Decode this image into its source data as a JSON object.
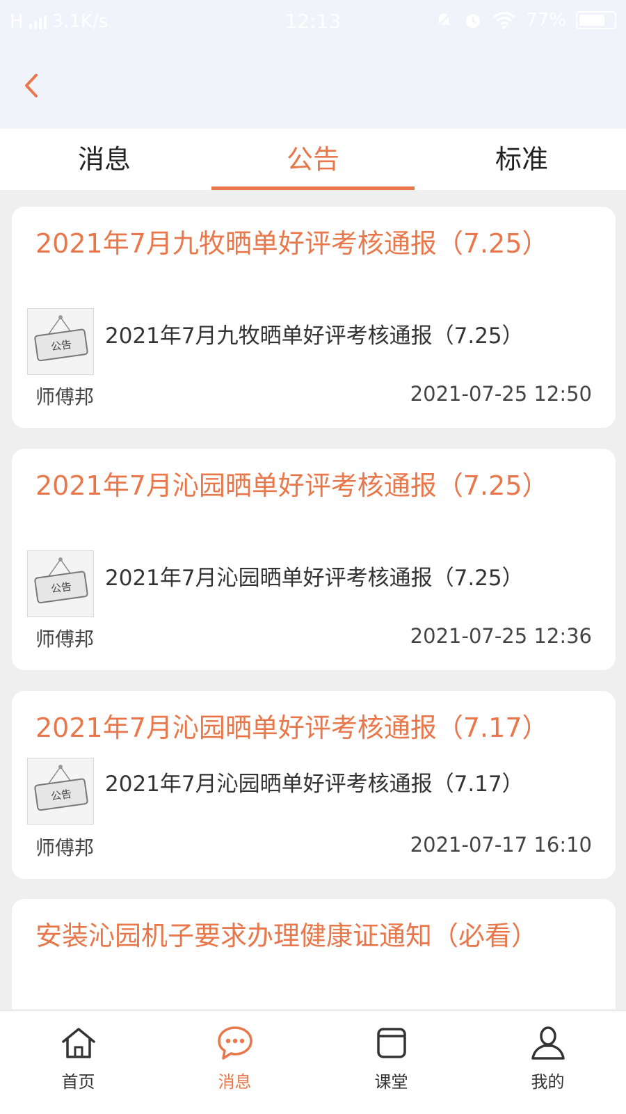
{
  "status_bar": {
    "network": "H",
    "speed": "3.1K/s",
    "time": "12:13",
    "battery": "77%"
  },
  "tabs": [
    {
      "label": "消息",
      "active": false
    },
    {
      "label": "公告",
      "active": true
    },
    {
      "label": "标准",
      "active": false
    }
  ],
  "thumb_label": "公告",
  "notices": [
    {
      "title": "2021年7月九牧晒单好评考核通报（7.25）",
      "summary": "2021年7月九牧晒单好评考核通报（7.25）",
      "author": "师傅邦",
      "time": "2021-07-25 12:50"
    },
    {
      "title": "2021年7月沁园晒单好评考核通报（7.25）",
      "summary": "2021年7月沁园晒单好评考核通报（7.25）",
      "author": "师傅邦",
      "time": "2021-07-25 12:36"
    },
    {
      "title": "2021年7月沁园晒单好评考核通报（7.17）",
      "summary": "2021年7月沁园晒单好评考核通报（7.17）",
      "author": "师傅邦",
      "time": "2021-07-17 16:10"
    },
    {
      "title": "安装沁园机子要求办理健康证通知（必看）"
    }
  ],
  "bottom_nav": [
    {
      "label": "首页",
      "icon": "home-icon",
      "active": false
    },
    {
      "label": "消息",
      "icon": "message-icon",
      "active": true
    },
    {
      "label": "课堂",
      "icon": "classroom-icon",
      "active": false
    },
    {
      "label": "我的",
      "icon": "profile-icon",
      "active": false
    }
  ],
  "colors": {
    "accent": "#e8774b",
    "header_bg": "#f1f3fb",
    "page_bg": "#efefef"
  }
}
